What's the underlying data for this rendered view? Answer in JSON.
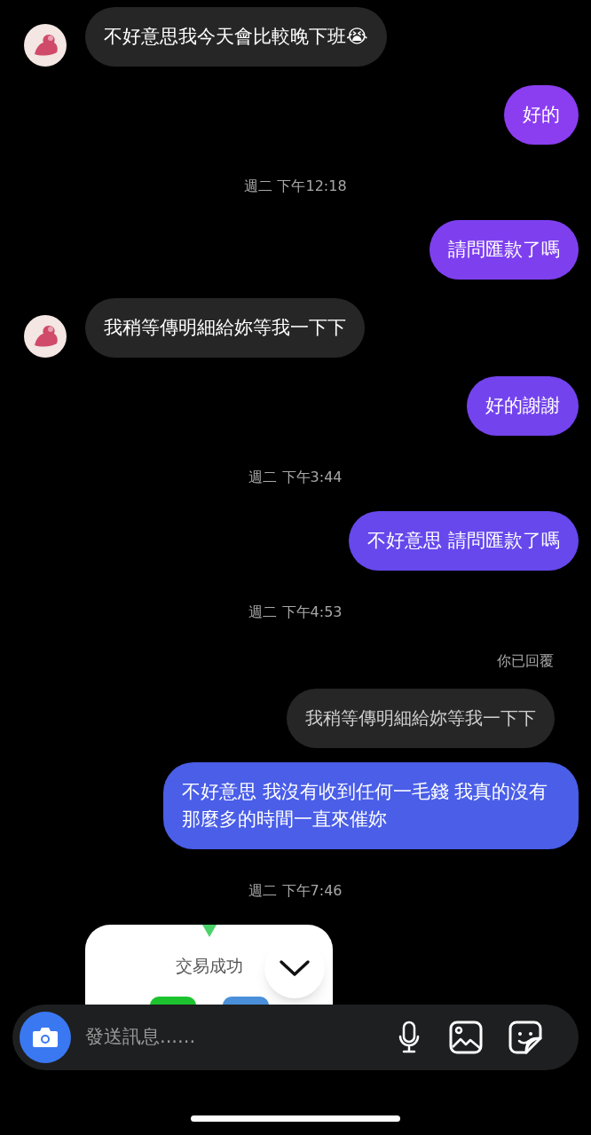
{
  "messages": [
    {
      "kind": "incoming",
      "text": "不好意思我今天會比較晚下班😭",
      "avatar": true
    },
    {
      "kind": "outgoing",
      "text": "好的",
      "color": "#8b3df0"
    },
    {
      "kind": "timestamp",
      "text": "週二 下午12:18"
    },
    {
      "kind": "outgoing",
      "text": "請問匯款了嗎",
      "color": "#7e40ef"
    },
    {
      "kind": "incoming",
      "text": "我稍等傳明細給妳等我一下下",
      "avatar": true
    },
    {
      "kind": "outgoing",
      "text": "好的謝謝",
      "color": "#7343ee"
    },
    {
      "kind": "timestamp",
      "text": "週二 下午3:44"
    },
    {
      "kind": "outgoing",
      "text": "不好意思 請問匯款了嗎",
      "color": "#6648ec"
    },
    {
      "kind": "timestamp",
      "text": "週二 下午4:53"
    },
    {
      "kind": "reply_label",
      "text": "你已回覆"
    },
    {
      "kind": "quoted",
      "text": "我稍等傳明細給妳等我一下下"
    },
    {
      "kind": "outgoing",
      "text": "不好意思 我沒有收到任何一毛錢 我真的沒有那麼多的時間一直來催妳",
      "color": "#4a5ee8"
    },
    {
      "kind": "timestamp",
      "text": "週二 下午7:46"
    },
    {
      "kind": "image",
      "caption": "交易成功"
    }
  ],
  "composer": {
    "placeholder": "發送訊息......"
  }
}
